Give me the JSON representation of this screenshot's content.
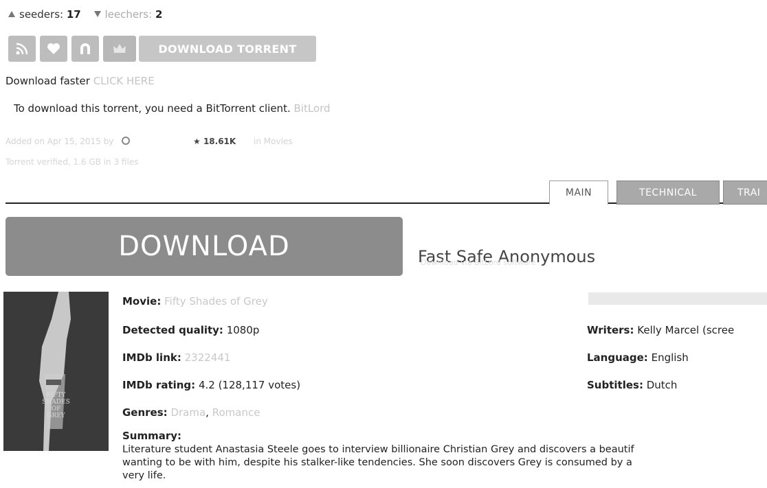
{
  "stats": {
    "seeders_label": "seeders:",
    "seeders_count": "17",
    "leechers_label": "leechers:",
    "leechers_count": "2"
  },
  "toolbar": {
    "icons": [
      "rss-icon",
      "heart-icon",
      "magnet-icon",
      "crown-icon"
    ],
    "download_torrent_label": "DOWNLOAD TORRENT"
  },
  "download_faster": {
    "text": "Download faster",
    "link": "CLICK HERE"
  },
  "client_notice": {
    "text": "To download this torrent, you need a BitTorrent client.",
    "link": "BitLord"
  },
  "meta": {
    "added": "Added on Apr 15, 2015 by",
    "downloads": "★ 18.61K",
    "category": "in Movies",
    "torrent_info": "Torrent verified, 1.6 GB in 3 files"
  },
  "tabs": [
    "MAIN",
    "TECHNICAL",
    "TRAI"
  ],
  "download_panel": {
    "big_button": "DOWNLOAD",
    "tagline": "Fast Safe Anonymous",
    "sub": "Download via BitLord software"
  },
  "poster": {
    "title_text": "FIFTY\nSHADES\nOF\nGREY"
  },
  "movie_info": {
    "movie_label": "Movie:",
    "movie_value": "Fifty Shades of Grey",
    "quality_label": "Detected quality:",
    "quality_value": "1080p",
    "imdb_link_label": "IMDb link:",
    "imdb_link_value": "2322441",
    "imdb_rating_label": "IMDb rating:",
    "imdb_rating_value": "4.2 (128,117 votes)",
    "genres_label": "Genres:",
    "genres": [
      "Drama",
      "Romance"
    ],
    "summary_label": "Summary:",
    "summary_text": "Literature student Anastasia Steele goes to interview billionaire Christian Grey and discovers a beautif\nwanting to be with him, despite his stalker-like tendencies. She soon discovers Grey is consumed by a\nvery life."
  },
  "side_info": {
    "writers_label": "Writers:",
    "writers_value": "Kelly Marcel (scree",
    "language_label": "Language:",
    "language_value": "English",
    "subtitles_label": "Subtitles:",
    "subtitles_value": "Dutch"
  },
  "colors": {
    "button_grey": "#8c8c8c",
    "icon_grey": "#bdbdbd",
    "link_faded": "#c4c4c4"
  }
}
